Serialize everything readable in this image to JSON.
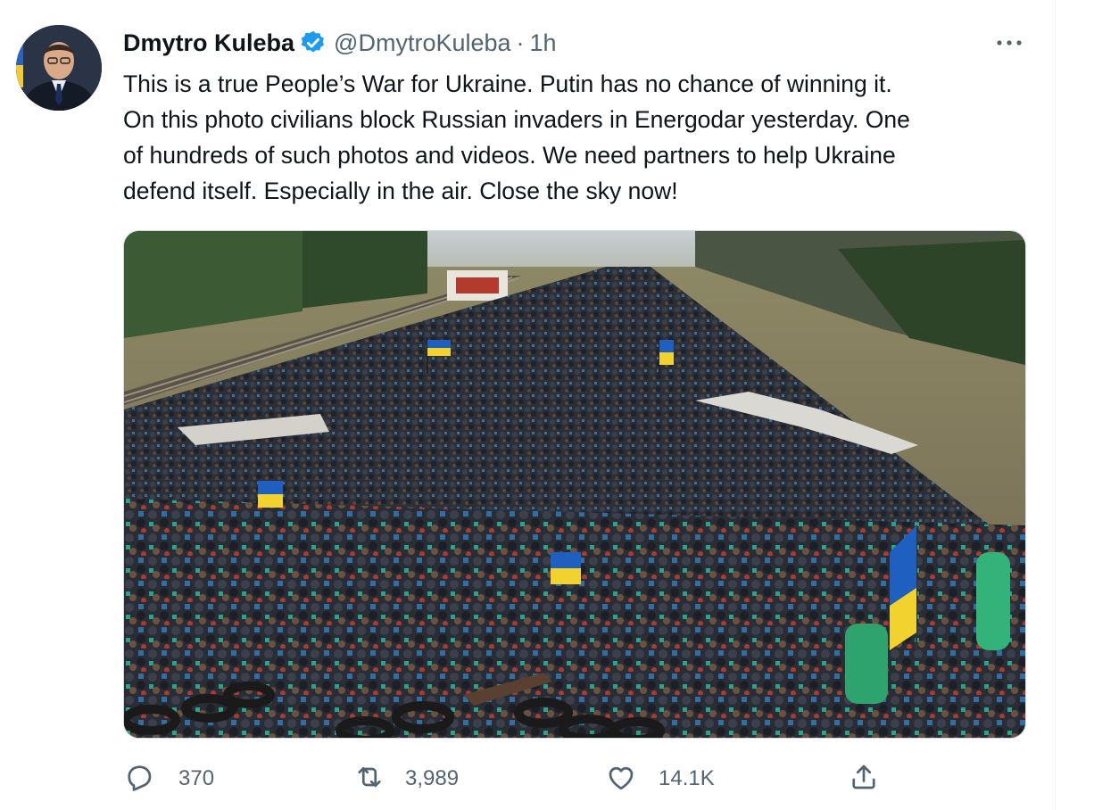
{
  "tweet": {
    "author_name": "Dmytro Kuleba",
    "handle": "@DmytroKuleba",
    "separator": "·",
    "time": "1h",
    "text_lines": [
      "This is a true People’s War for Ukraine. Putin has no chance of winning it.",
      "On this photo civilians block Russian invaders in Energodar yesterday. One",
      "of hundreds of such photos and videos. We need partners to help Ukraine",
      "defend itself. Especially in the air. Close the sky now!"
    ]
  },
  "media": {
    "description_icon": "photo of crowd of civilians on road blocking convoy, with Ukrainian flags, tires and sandbags"
  },
  "actions": {
    "reply_count": "370",
    "retweet_count": "3,989",
    "like_count": "14.1K"
  },
  "colors": {
    "verified": "#1d9bf0",
    "text": "#0f1419",
    "secondary": "#536471",
    "flag_blue": "#1f5fbf",
    "flag_yellow": "#f2d22e"
  }
}
